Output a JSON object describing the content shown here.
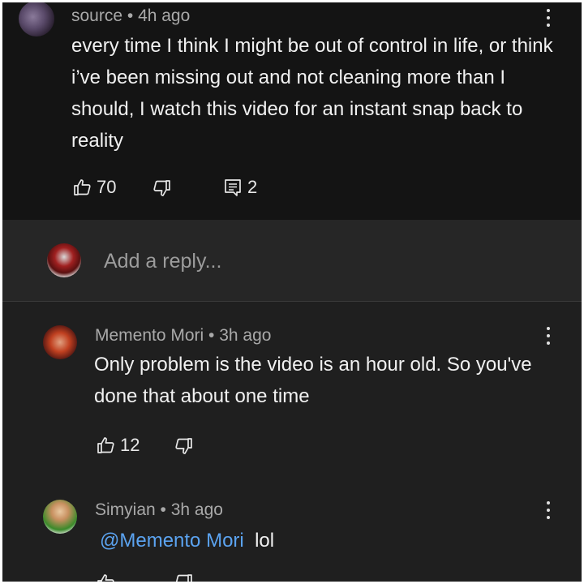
{
  "main_comment": {
    "author": "source",
    "separator": " • ",
    "time": "4h ago",
    "text": "every time I think I might be out of control in life, or think i’ve been missing out and not cleaning more than I should, I watch this video for an instant snap back to reality",
    "likes": "70",
    "replies": "2",
    "avatar_icon": "user-avatar-icon"
  },
  "reply_input": {
    "placeholder": "Add a reply..."
  },
  "replies": [
    {
      "author": "Memento Mori",
      "separator": " • ",
      "time": "3h ago",
      "text": "Only problem is the video is an hour old. So you've done that about one time",
      "likes": "12"
    },
    {
      "author": "Simyian",
      "separator": " • ",
      "time": "3h ago",
      "mention": "@Memento Mori",
      "text": "lol"
    }
  ],
  "colors": {
    "background": "#141414",
    "reply_bar": "#262626",
    "mention": "#5ba3f0"
  }
}
